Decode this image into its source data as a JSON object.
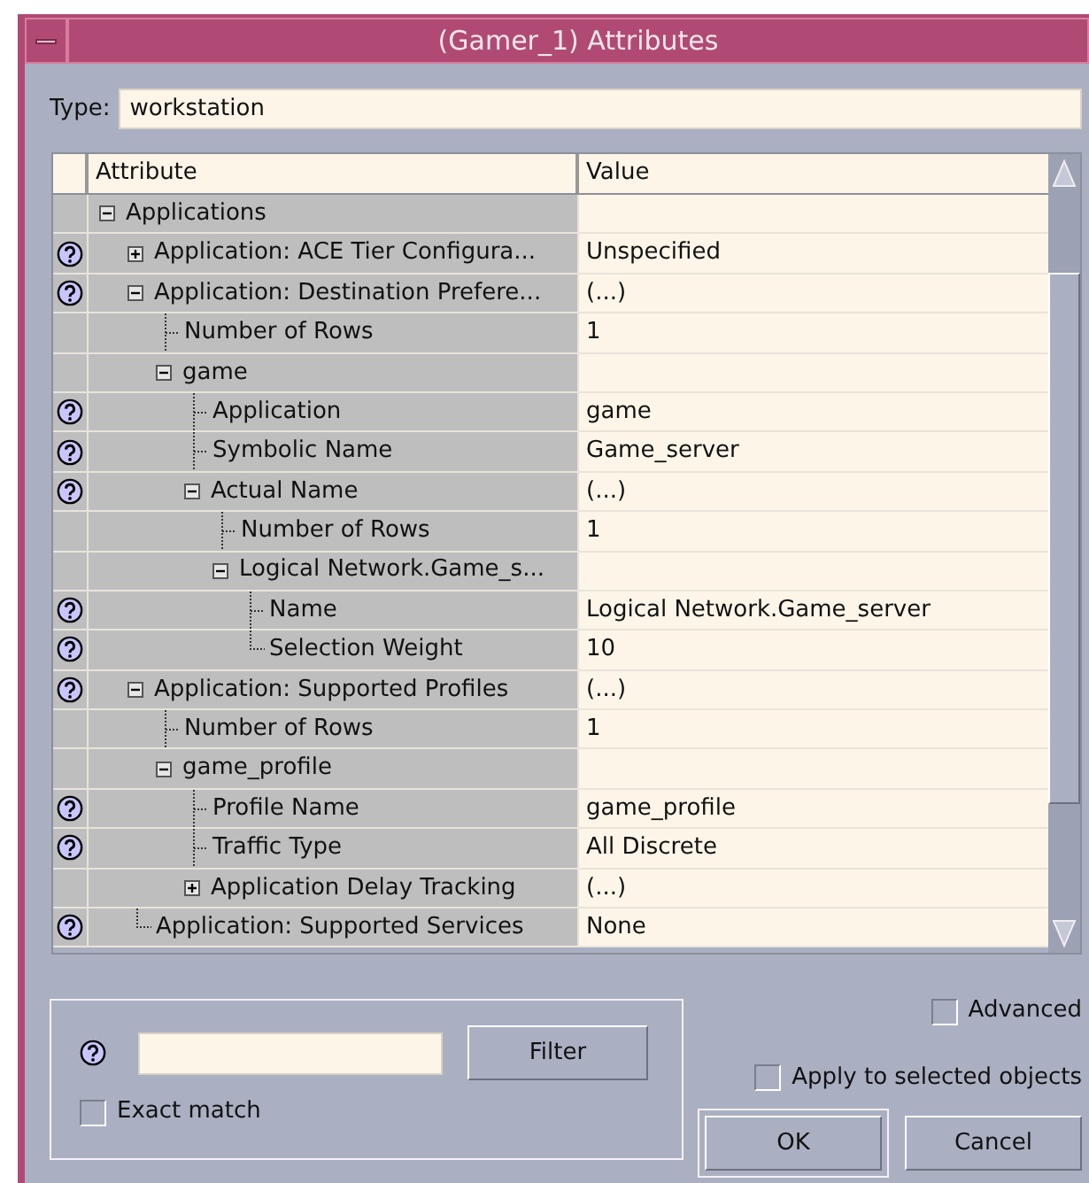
{
  "window": {
    "title": "(Gamer_1) Attributes"
  },
  "type_field": {
    "label": "Type:",
    "value": "workstation"
  },
  "table": {
    "columns": [
      "Attribute",
      "Value"
    ],
    "rows": [
      {
        "label": "Applications",
        "help": false,
        "expanded": true,
        "children": [
          {
            "label": "Application: ACE Tier Configura...",
            "value": "Unspecified",
            "help": true,
            "expanded": false
          },
          {
            "label": "Application: Destination Prefere...",
            "value": "(...)",
            "help": true,
            "expanded": true,
            "children": [
              {
                "label": "Number of Rows",
                "value": "1",
                "help": false
              },
              {
                "label": "game",
                "help": false,
                "expanded": true,
                "children": [
                  {
                    "label": "Application",
                    "value": "game",
                    "help": true
                  },
                  {
                    "label": "Symbolic Name",
                    "value": "Game_server",
                    "help": true
                  },
                  {
                    "label": "Actual Name",
                    "value": "(...)",
                    "help": true,
                    "expanded": true,
                    "children": [
                      {
                        "label": "Number of Rows",
                        "value": "1",
                        "help": false
                      },
                      {
                        "label": "Logical Network.Game_s...",
                        "help": false,
                        "expanded": true,
                        "children": [
                          {
                            "label": "Name",
                            "value": "Logical Network.Game_server",
                            "help": true
                          },
                          {
                            "label": "Selection Weight",
                            "value": "10",
                            "help": true
                          }
                        ]
                      }
                    ]
                  }
                ]
              }
            ]
          },
          {
            "label": "Application: Supported Profiles",
            "value": "(...)",
            "help": true,
            "expanded": true,
            "children": [
              {
                "label": "Number of Rows",
                "value": "1",
                "help": false
              },
              {
                "label": "game_profile",
                "help": false,
                "expanded": true,
                "children": [
                  {
                    "label": "Profile Name",
                    "value": "game_profile",
                    "help": true
                  },
                  {
                    "label": "Traffic Type",
                    "value": "All Discrete",
                    "help": true
                  },
                  {
                    "label": "Application Delay Tracking",
                    "value": "(...)",
                    "help": false,
                    "expanded": false
                  }
                ]
              }
            ]
          },
          {
            "label": "Application: Supported Services",
            "value": "None",
            "help": true
          }
        ]
      }
    ]
  },
  "filter": {
    "button": {
      "label": "Filter"
    },
    "exact_match": {
      "label": "Exact match",
      "checked": false
    }
  },
  "advanced": {
    "label": "Advanced",
    "checked": false
  },
  "apply_selected": {
    "label": "Apply to selected objects",
    "checked": false
  },
  "buttons": [
    {
      "label": "OK",
      "default": true
    },
    {
      "label": "Cancel",
      "default": false
    }
  ]
}
